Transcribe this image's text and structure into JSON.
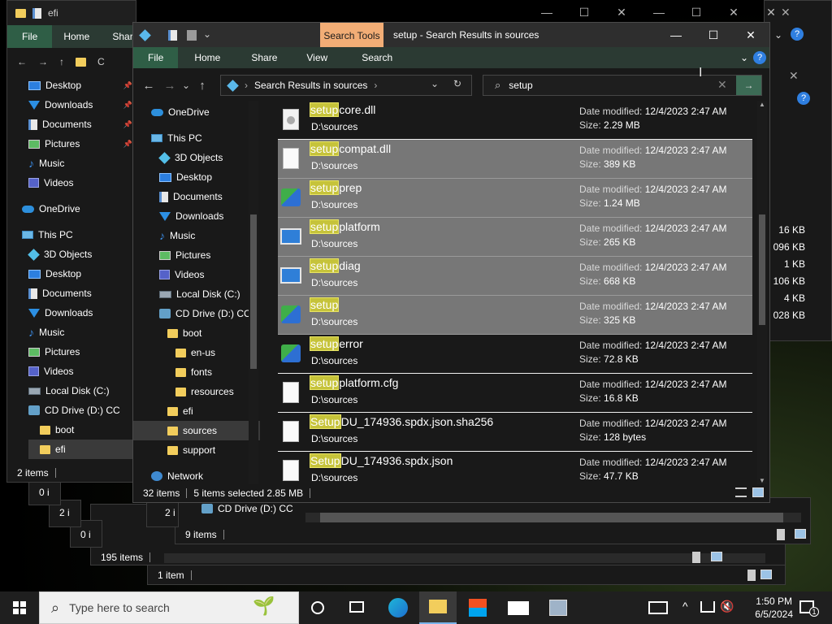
{
  "colors": {
    "selection": "#777777",
    "highlight": "#c6c33a",
    "ribbon": "#2b3a33",
    "accent": "#2f5e46",
    "search_tools_tab": "#f2ad76"
  },
  "back_window": {
    "title": "efi",
    "ribbon": [
      "File",
      "Home",
      "Share"
    ],
    "address_fragment": "C",
    "status_items": "2 items",
    "nav": [
      {
        "label": "Desktop",
        "icon": "desktop-icon",
        "pinned": true
      },
      {
        "label": "Downloads",
        "icon": "download-icon",
        "pinned": true
      },
      {
        "label": "Documents",
        "icon": "document-icon",
        "pinned": true
      },
      {
        "label": "Pictures",
        "icon": "pictures-icon",
        "pinned": true
      },
      {
        "label": "Music",
        "icon": "music-icon"
      },
      {
        "label": "Videos",
        "icon": "videos-icon"
      },
      {
        "label": "OneDrive",
        "icon": "onedrive-icon"
      },
      {
        "label": "This PC",
        "icon": "pc-icon"
      },
      {
        "label": "3D Objects",
        "icon": "3d-objects-icon"
      },
      {
        "label": "Desktop",
        "icon": "desktop-icon"
      },
      {
        "label": "Documents",
        "icon": "document-icon"
      },
      {
        "label": "Downloads",
        "icon": "download-icon"
      },
      {
        "label": "Music",
        "icon": "music-icon"
      },
      {
        "label": "Pictures",
        "icon": "pictures-icon"
      },
      {
        "label": "Videos",
        "icon": "videos-icon"
      },
      {
        "label": "Local Disk (C:)",
        "icon": "disk-icon"
      },
      {
        "label": "CD Drive (D:) CC",
        "icon": "cd-drive-icon"
      },
      {
        "label": "boot",
        "icon": "folder-icon"
      },
      {
        "label": "efi",
        "icon": "folder-icon"
      }
    ]
  },
  "right_window": {
    "sizes": [
      "16 KB",
      "096 KB",
      "1 KB",
      "106 KB",
      "4 KB",
      "028 KB"
    ]
  },
  "stacked_status": {
    "w1": "0 i",
    "w2": "2 i",
    "w3": "2 i",
    "w4": "0 i",
    "w5_tree": "CD Drive (D:) CC",
    "w5_items": "9 items",
    "w6_items": "195 items",
    "w7_items": "1 item"
  },
  "main": {
    "contextual_tab": "Search Tools",
    "title": "setup - Search Results in sources",
    "ribbon": {
      "file": "File",
      "home": "Home",
      "share": "Share",
      "view": "View",
      "search": "Search"
    },
    "address": "Search Results in sources",
    "search_value": "setup",
    "nav": [
      {
        "label": "OneDrive",
        "icon": "onedrive-icon",
        "indent": 0
      },
      {
        "label": "This PC",
        "icon": "pc-icon",
        "indent": 0
      },
      {
        "label": "3D Objects",
        "icon": "3d-objects-icon",
        "indent": 1
      },
      {
        "label": "Desktop",
        "icon": "desktop-icon",
        "indent": 1
      },
      {
        "label": "Documents",
        "icon": "document-icon",
        "indent": 1
      },
      {
        "label": "Downloads",
        "icon": "download-icon",
        "indent": 1
      },
      {
        "label": "Music",
        "icon": "music-icon",
        "indent": 1
      },
      {
        "label": "Pictures",
        "icon": "pictures-icon",
        "indent": 1
      },
      {
        "label": "Videos",
        "icon": "videos-icon",
        "indent": 1
      },
      {
        "label": "Local Disk (C:)",
        "icon": "disk-icon",
        "indent": 1
      },
      {
        "label": "CD Drive (D:) CC",
        "icon": "cd-drive-icon",
        "indent": 1
      },
      {
        "label": "boot",
        "icon": "folder-icon",
        "indent": 2
      },
      {
        "label": "en-us",
        "icon": "folder-icon",
        "indent": 3
      },
      {
        "label": "fonts",
        "icon": "folder-icon",
        "indent": 3
      },
      {
        "label": "resources",
        "icon": "folder-icon",
        "indent": 3
      },
      {
        "label": "efi",
        "icon": "folder-icon",
        "indent": 2
      },
      {
        "label": "sources",
        "icon": "folder-icon",
        "indent": 2,
        "selected": true
      },
      {
        "label": "support",
        "icon": "folder-icon",
        "indent": 2
      },
      {
        "label": "Network",
        "icon": "network-icon",
        "indent": 0
      }
    ],
    "results": [
      {
        "hl": "setup",
        "rest": "core.dll",
        "path": "D:\\sources",
        "date_label": "Date modified:",
        "date": "12/4/2023 2:47 AM",
        "size_label": "Size:",
        "size": "2.29 MB",
        "icon": "dll-icon",
        "selected": false
      },
      {
        "hl": "setup",
        "rest": "compat.dll",
        "path": "D:\\sources",
        "date_label": "Date modified:",
        "date": "12/4/2023 2:47 AM",
        "size_label": "Size:",
        "size": "389 KB",
        "icon": "file-icon",
        "selected": true
      },
      {
        "hl": "setup",
        "rest": "prep",
        "path": "D:\\sources",
        "date_label": "Date modified:",
        "date": "12/4/2023 2:47 AM",
        "size_label": "Size:",
        "size": "1.24 MB",
        "icon": "setup-icon",
        "selected": true
      },
      {
        "hl": "setup",
        "rest": "platform",
        "path": "D:\\sources",
        "date_label": "Date modified:",
        "date": "12/4/2023 2:47 AM",
        "size_label": "Size:",
        "size": "265 KB",
        "icon": "app-window-icon",
        "selected": true
      },
      {
        "hl": "setup",
        "rest": "diag",
        "path": "D:\\sources",
        "date_label": "Date modified:",
        "date": "12/4/2023 2:47 AM",
        "size_label": "Size:",
        "size": "668 KB",
        "icon": "app-window-icon",
        "selected": true
      },
      {
        "hl": "setup",
        "rest": "",
        "path": "D:\\sources",
        "date_label": "Date modified:",
        "date": "12/4/2023 2:47 AM",
        "size_label": "Size:",
        "size": "325 KB",
        "icon": "setup-icon",
        "selected": true
      },
      {
        "hl": "setup",
        "rest": "error",
        "path": "D:\\sources",
        "date_label": "Date modified:",
        "date": "12/4/2023 2:47 AM",
        "size_label": "Size:",
        "size": "72.8 KB",
        "icon": "setup-icon",
        "selected": false
      },
      {
        "hl": "setup",
        "rest": "platform.cfg",
        "path": "D:\\sources",
        "date_label": "Date modified:",
        "date": "12/4/2023 2:47 AM",
        "size_label": "Size:",
        "size": "16.8 KB",
        "icon": "file-icon",
        "selected": false
      },
      {
        "hl": "Setup",
        "rest": "DU_174936.spdx.json.sha256",
        "path": "D:\\sources",
        "date_label": "Date modified:",
        "date": "12/4/2023 2:47 AM",
        "size_label": "Size:",
        "size": "128 bytes",
        "icon": "file-icon",
        "selected": false
      },
      {
        "hl": "Setup",
        "rest": "DU_174936.spdx.json",
        "path": "D:\\sources",
        "date_label": "Date modified:",
        "date": "12/4/2023 2:47 AM",
        "size_label": "Size:",
        "size": "47.7 KB",
        "icon": "file-icon",
        "selected": false
      }
    ],
    "status": {
      "items": "32 items",
      "selected": "5 items selected  2.85 MB"
    }
  },
  "taskbar": {
    "search_placeholder": "Type here to search",
    "time": "1:50 PM",
    "date": "6/5/2024",
    "notification_count": "1"
  }
}
